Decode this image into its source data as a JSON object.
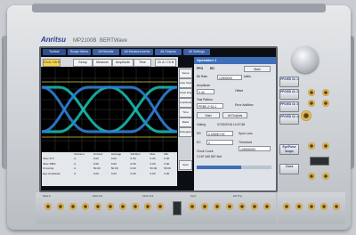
{
  "brand": {
    "logo": "Anritsu",
    "model": "MP2100B",
    "series": "BERTWave"
  },
  "screen": {
    "tabs": [
      "Toolbar",
      "Scope Menu",
      "All Results",
      "All Measurements",
      "All Outputs",
      "All Settings"
    ],
    "scope_toolbar": [
      "Ch A / Ch B",
      "Setup",
      "Measure",
      "Amplitude",
      "Time",
      "Ch A / Ch B"
    ],
    "scope_side": [
      "Setup",
      "Auto Scale",
      "Clear Display",
      "Amplitude",
      "Time",
      "Mask",
      "Histogram",
      "Save"
    ],
    "meas_headers": [
      "",
      "Channel",
      "Current",
      "Average",
      "Std.Dev.",
      "Max",
      "Min"
    ],
    "meas_rows": [
      [
        "Jitter P-P",
        "A",
        "0.00",
        "0.00",
        "0.00",
        "0.00",
        "0.00"
      ],
      [
        "Jitter RMS",
        "A",
        "0.00",
        "0.00",
        "0.00",
        "0.00",
        "0.00"
      ],
      [
        "Crossing",
        "A",
        "50.00",
        "50.00",
        "0.00",
        "50.00",
        "50.00"
      ],
      [
        "Eye Amplitude",
        "A",
        "0.00",
        "0.00",
        "0.00",
        "0.00",
        "0.00"
      ]
    ],
    "ppg": {
      "header": "Operation 1",
      "ppg_label": "PPG",
      "ed_label": "ED",
      "main_btn": "Main",
      "bitrate_label": "Bit Rate",
      "bitrate_value": "12500000",
      "bitrate_unit": "kbit/s",
      "amp_label": "Amplitude",
      "amp_value": "0.40",
      "offset_label": "Offset",
      "pattern_label": "Test Pattern",
      "pattern_value": "PRBS 2^31-1",
      "error_label": "Error Addition",
      "start_btn": "Start",
      "all_outputs": "All Outputs",
      "gating_label": "Gating",
      "gating_value": "07/02/2016 14:47:58",
      "er_label": "ER",
      "er_value": "0.0000E+00",
      "ec_label": "EC",
      "ec_value": "0",
      "clk_label": "Clock Count",
      "clk_value": "2.187 465 867 kbit",
      "sync_label": "Sync Loss",
      "threshold_label": "Threshold",
      "threshold_value": "125000000"
    }
  },
  "modules": [
    {
      "label": "PPG/ED Ch 1"
    },
    {
      "label": "PPG/ED Ch 2"
    },
    {
      "label": "PPG/ED Ch 3"
    },
    {
      "label": "PPG/ED Ch 4"
    },
    {
      "label": "Eye/Pulse Scope"
    },
    {
      "label": "Clock"
    }
  ],
  "bottom_labels": [
    "Data In",
    "Data Out",
    "Clock Out",
    "Sync",
    "Ext Trig"
  ]
}
